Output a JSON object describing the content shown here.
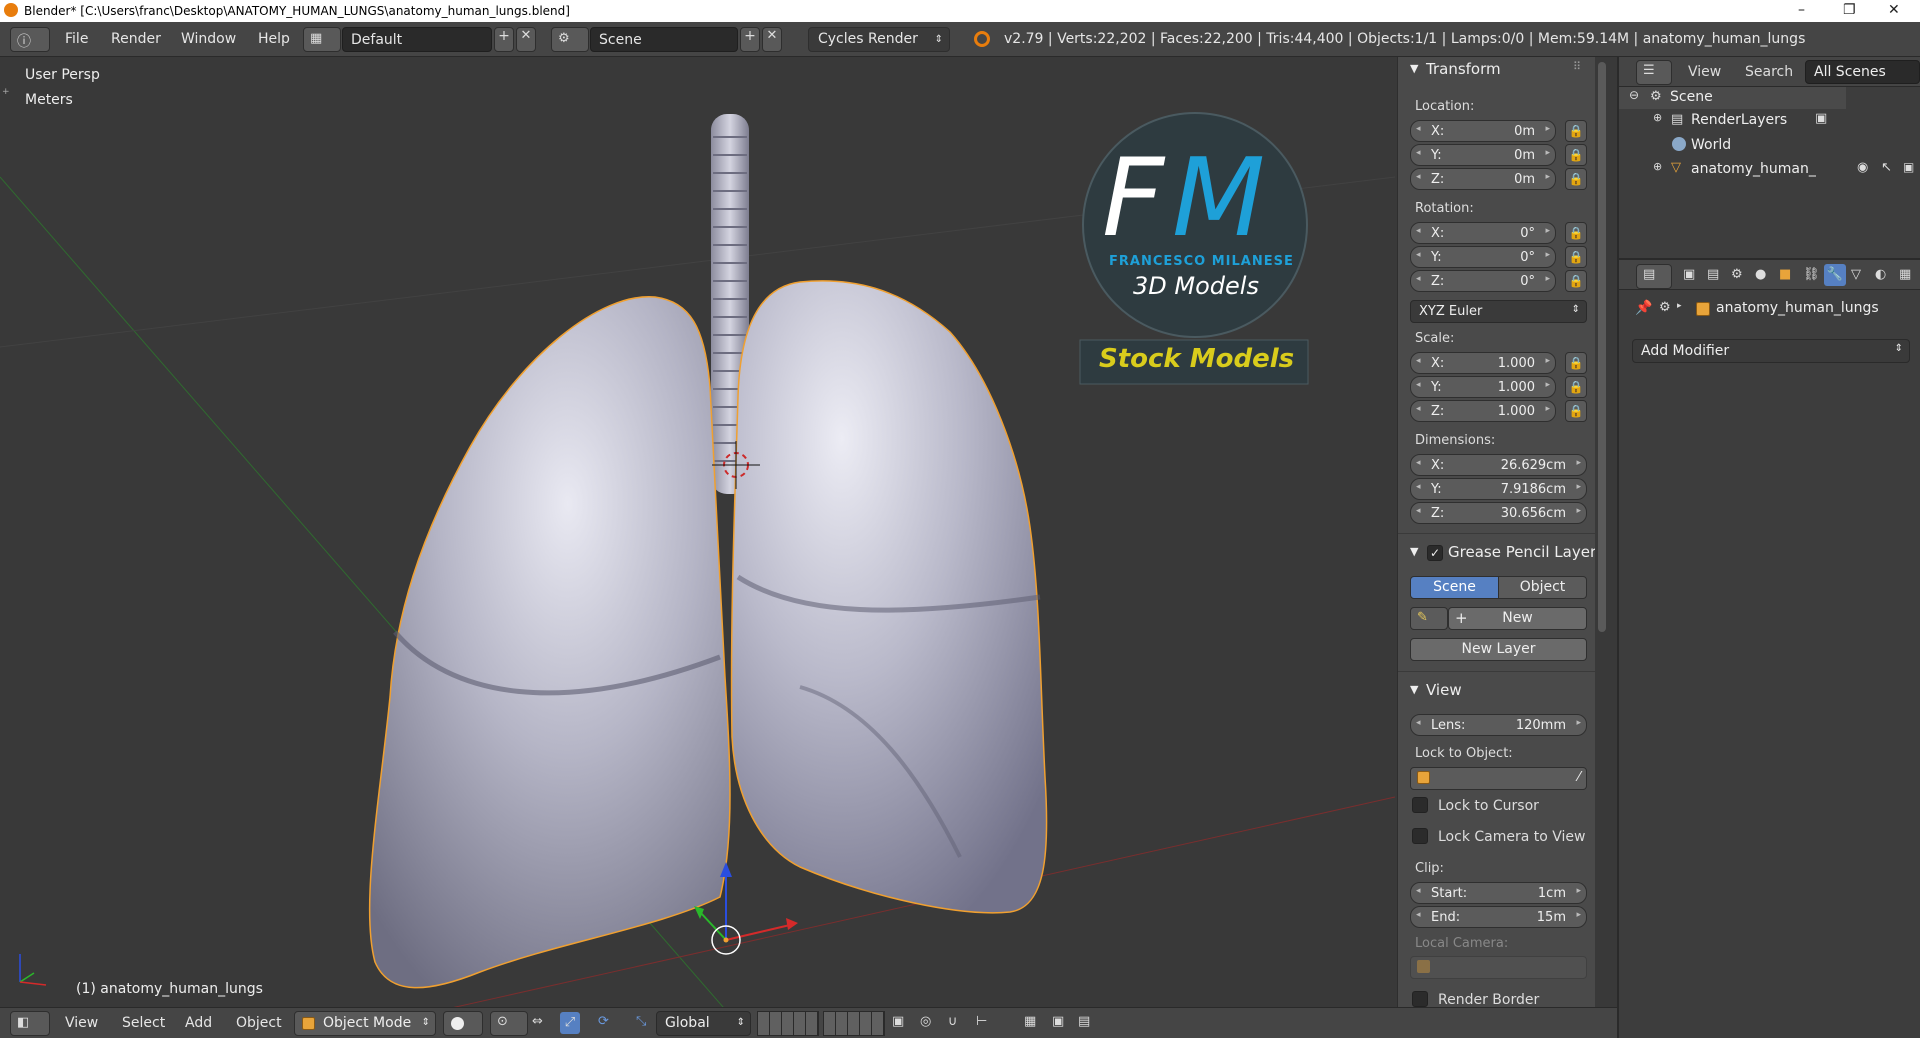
{
  "window": {
    "title": "Blender* [C:\\Users\\franc\\Desktop\\ANATOMY_HUMAN_LUNGS\\anatomy_human_lungs.blend]",
    "minimize": "–",
    "maximize": "❐",
    "close": "✕"
  },
  "topbar": {
    "menus": [
      "File",
      "Render",
      "Window",
      "Help"
    ],
    "layout": "Default",
    "scene": "Scene",
    "engine": "Cycles Render",
    "stats": "v2.79 | Verts:22,202 | Faces:22,200 | Tris:44,400 | Objects:1/1 | Lamps:0/0 | Mem:59.14M | anatomy_human_lungs"
  },
  "viewport": {
    "view_name": "User Persp",
    "units": "Meters",
    "object_label": "(1) anatomy_human_lungs",
    "watermark": {
      "initials_f": "F",
      "initials_m": "M",
      "name": "FRANCESCO MILANESE",
      "tagline": "3D Models",
      "banner": "Stock Models"
    }
  },
  "npanel": {
    "transform": {
      "header": "Transform",
      "location_label": "Location:",
      "location": [
        {
          "axis": "X:",
          "value": "0m"
        },
        {
          "axis": "Y:",
          "value": "0m"
        },
        {
          "axis": "Z:",
          "value": "0m"
        }
      ],
      "rotation_label": "Rotation:",
      "rotation": [
        {
          "axis": "X:",
          "value": "0°"
        },
        {
          "axis": "Y:",
          "value": "0°"
        },
        {
          "axis": "Z:",
          "value": "0°"
        }
      ],
      "rotation_mode": "XYZ Euler",
      "scale_label": "Scale:",
      "scale": [
        {
          "axis": "X:",
          "value": "1.000"
        },
        {
          "axis": "Y:",
          "value": "1.000"
        },
        {
          "axis": "Z:",
          "value": "1.000"
        }
      ],
      "dimensions_label": "Dimensions:",
      "dimensions": [
        {
          "axis": "X:",
          "value": "26.629cm"
        },
        {
          "axis": "Y:",
          "value": "7.9186cm"
        },
        {
          "axis": "Z:",
          "value": "30.656cm"
        }
      ]
    },
    "grease_pencil": {
      "header": "Grease Pencil Layer",
      "tab_scene": "Scene",
      "tab_object": "Object",
      "new": "New",
      "new_layer": "New Layer"
    },
    "view": {
      "header": "View",
      "lens_label": "Lens:",
      "lens_value": "120mm",
      "lock_to_object": "Lock to Object:",
      "lock_to_cursor": "Lock to Cursor",
      "lock_camera": "Lock Camera to View",
      "clip_label": "Clip:",
      "clip_start_label": "Start:",
      "clip_start": "1cm",
      "clip_end_label": "End:",
      "clip_end": "15m",
      "local_camera": "Local Camera:",
      "render_border": "Render Border"
    }
  },
  "outliner": {
    "menus": [
      "View",
      "Search"
    ],
    "filter": "All Scenes",
    "items": [
      "Scene",
      "RenderLayers",
      "World",
      "anatomy_human_lungs"
    ]
  },
  "properties": {
    "object_name": "anatomy_human_lungs",
    "add_modifier": "Add Modifier"
  },
  "bottombar": {
    "menus": [
      "View",
      "Select",
      "Add",
      "Object"
    ],
    "mode": "Object Mode",
    "orientation": "Global"
  },
  "colors": {
    "accent_blue": "#5680c2",
    "selection_orange": "#f0a030",
    "logo_cyan": "#1ea0d8",
    "banner_yellow": "#d9cc1c"
  }
}
